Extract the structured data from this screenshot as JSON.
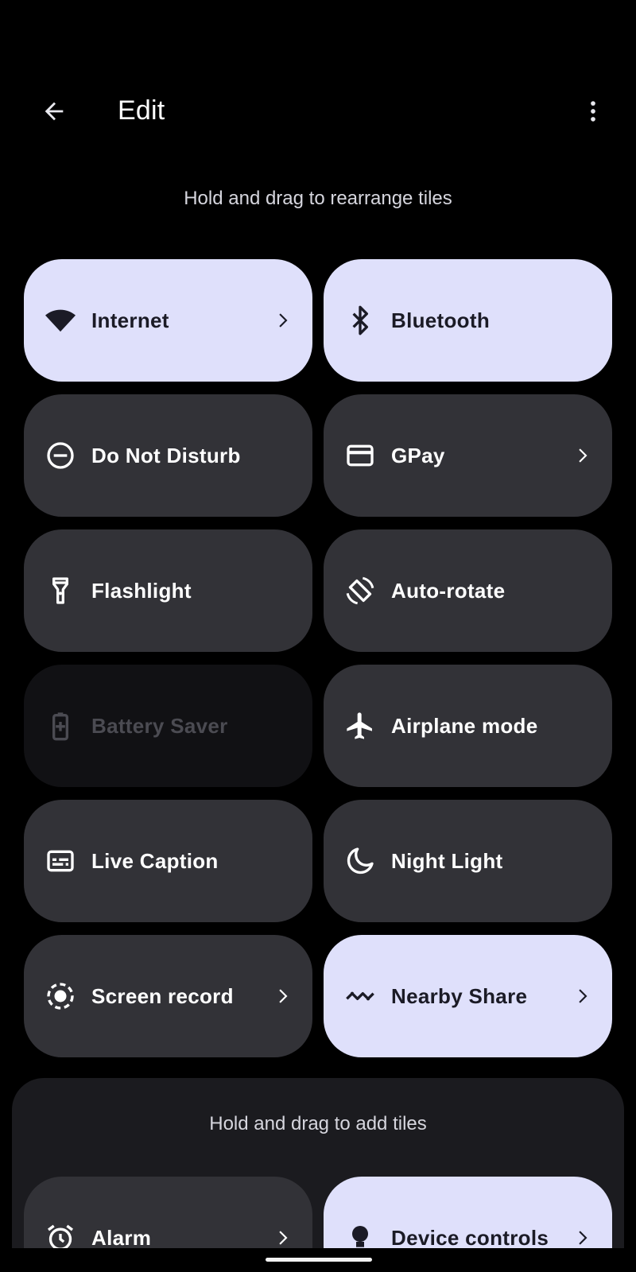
{
  "app_bar": {
    "title": "Edit",
    "back_icon": "arrow-left-icon",
    "more_icon": "more-vertical-icon"
  },
  "active_section": {
    "hint": "Hold and drag to rearrange tiles",
    "tiles": [
      {
        "label": "Internet",
        "state": "on",
        "icon": "wifi-icon",
        "chevron": true
      },
      {
        "label": "Bluetooth",
        "state": "on",
        "icon": "bluetooth-icon",
        "chevron": false
      },
      {
        "label": "Do Not Disturb",
        "state": "off",
        "icon": "do-not-disturb-icon",
        "chevron": false
      },
      {
        "label": "GPay",
        "state": "off",
        "icon": "credit-card-icon",
        "chevron": true
      },
      {
        "label": "Flashlight",
        "state": "off",
        "icon": "flashlight-icon",
        "chevron": false
      },
      {
        "label": "Auto-rotate",
        "state": "off",
        "icon": "auto-rotate-icon",
        "chevron": false
      },
      {
        "label": "Battery Saver",
        "state": "unavailable",
        "icon": "battery-saver-icon",
        "chevron": false
      },
      {
        "label": "Airplane mode",
        "state": "off",
        "icon": "airplane-icon",
        "chevron": false
      },
      {
        "label": "Live Caption",
        "state": "off",
        "icon": "caption-icon",
        "chevron": false
      },
      {
        "label": "Night Light",
        "state": "off",
        "icon": "moon-icon",
        "chevron": false
      },
      {
        "label": "Screen record",
        "state": "off",
        "icon": "screen-record-icon",
        "chevron": true
      },
      {
        "label": "Nearby Share",
        "state": "on",
        "icon": "nearby-share-icon",
        "chevron": true
      }
    ]
  },
  "add_section": {
    "hint": "Hold and drag to add tiles",
    "tiles": [
      {
        "label": "Alarm",
        "state": "off",
        "icon": "alarm-icon",
        "chevron": true
      },
      {
        "label": "Device controls",
        "state": "on",
        "icon": "device-controls-icon",
        "chevron": true
      }
    ]
  },
  "colors": {
    "tile_on": "#dfe0fb",
    "tile_off": "#323237",
    "tile_unavailable": "#111114",
    "panel": "#1b1b1f"
  }
}
